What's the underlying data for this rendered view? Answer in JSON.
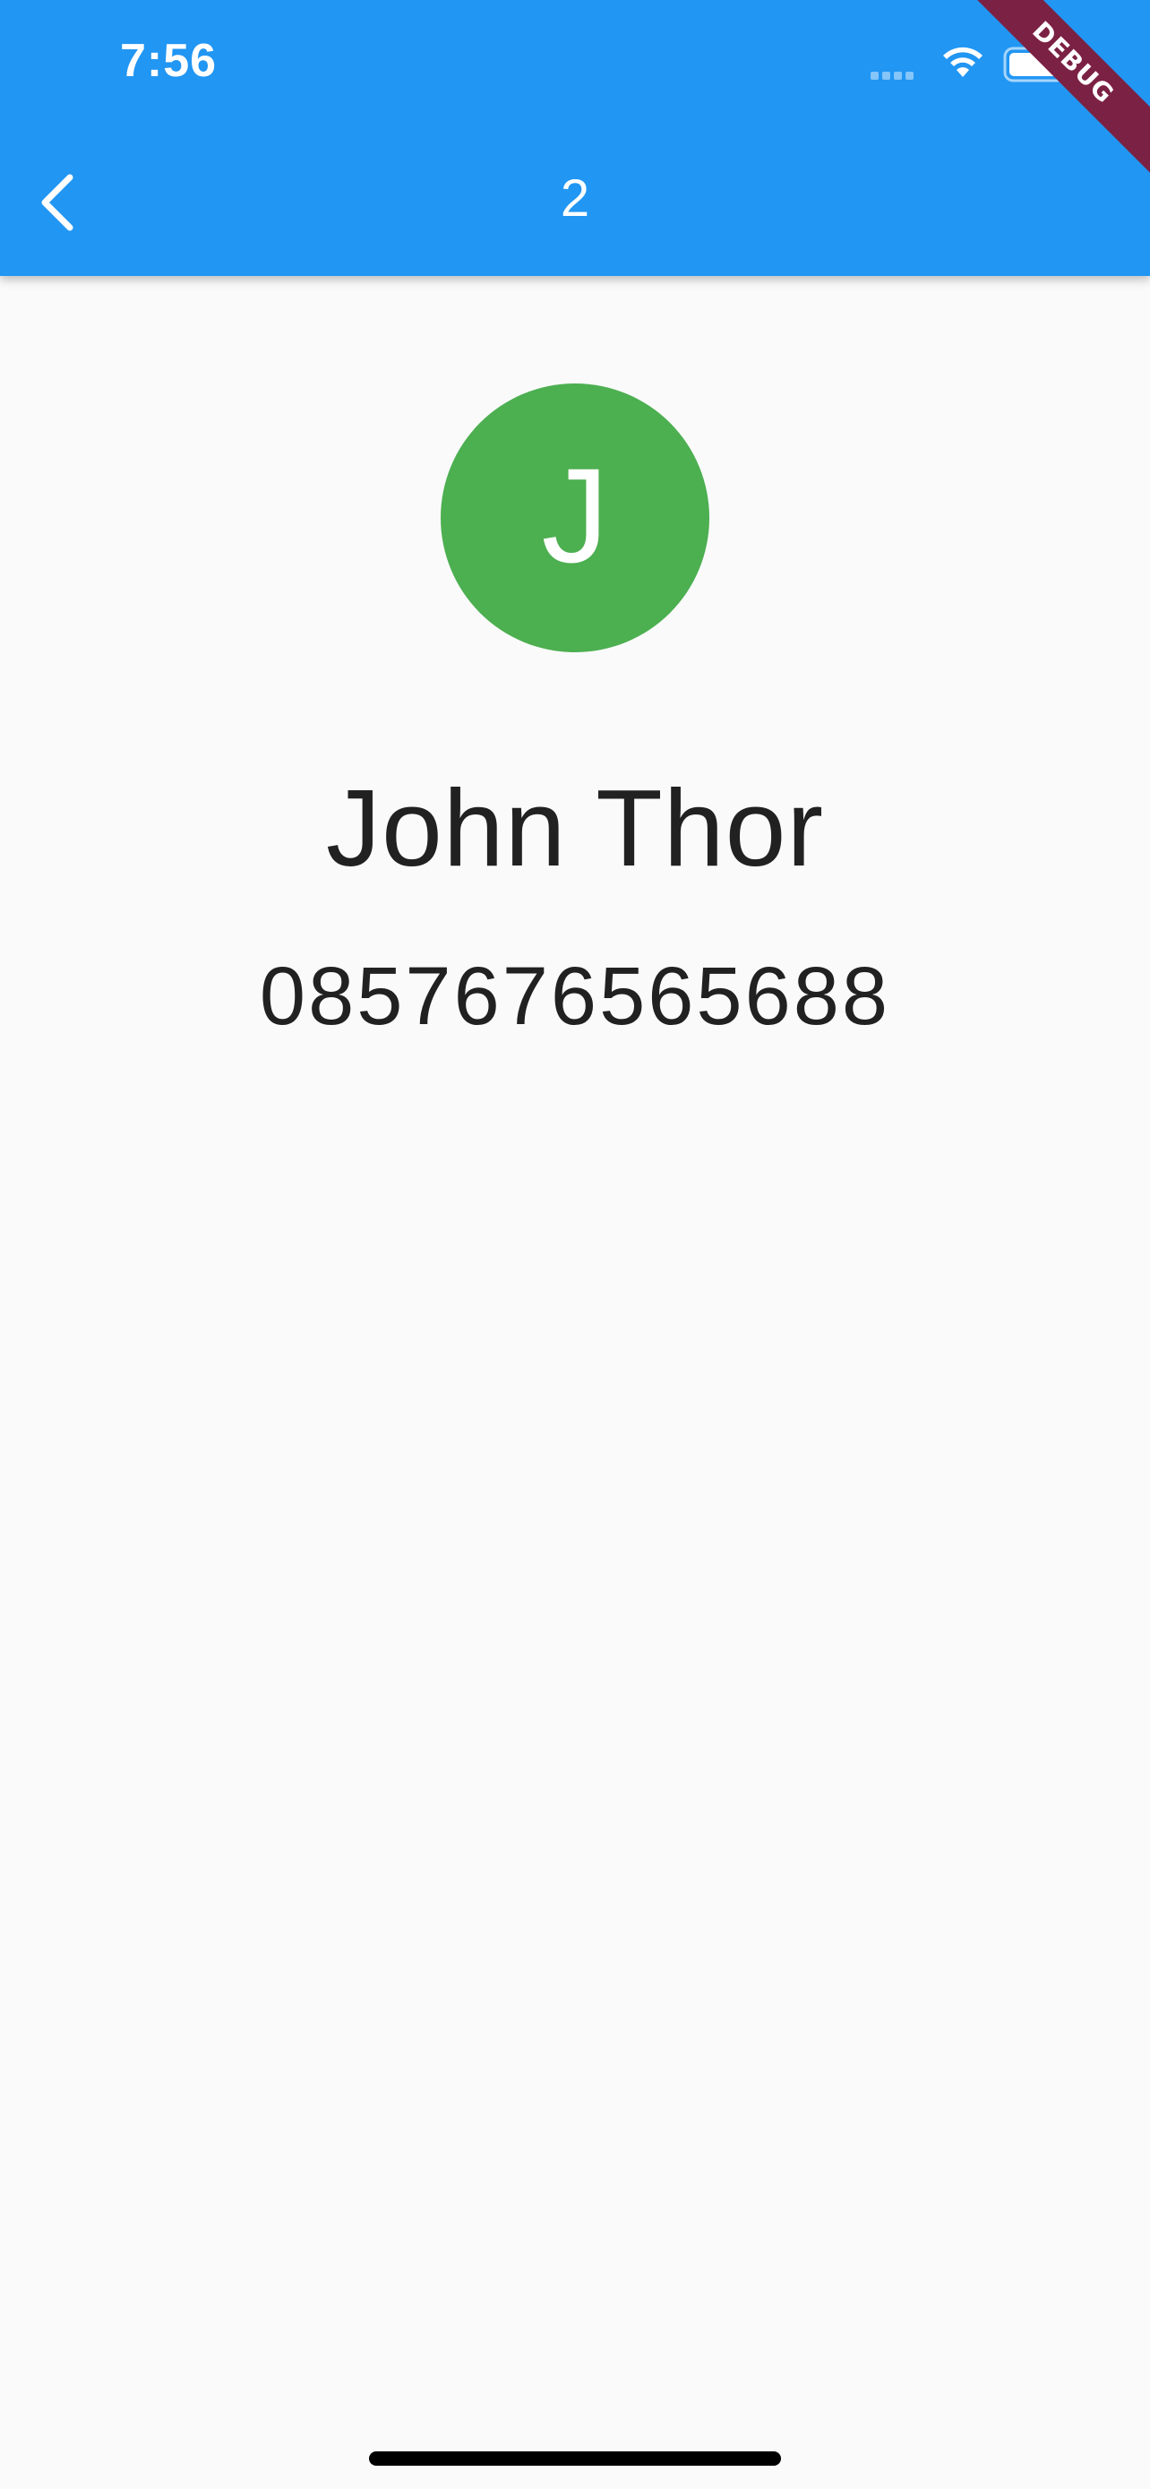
{
  "status_bar": {
    "time": "7:56"
  },
  "app_bar": {
    "title": "2",
    "background_color": "#2196f3",
    "back_icon": "chevron-left-icon"
  },
  "debug_banner": {
    "label": "DEBUG",
    "color": "#7b2144"
  },
  "contact": {
    "avatar_initial": "J",
    "avatar_color": "#4caf50",
    "name": "John Thor",
    "phone": "0857676565688"
  }
}
